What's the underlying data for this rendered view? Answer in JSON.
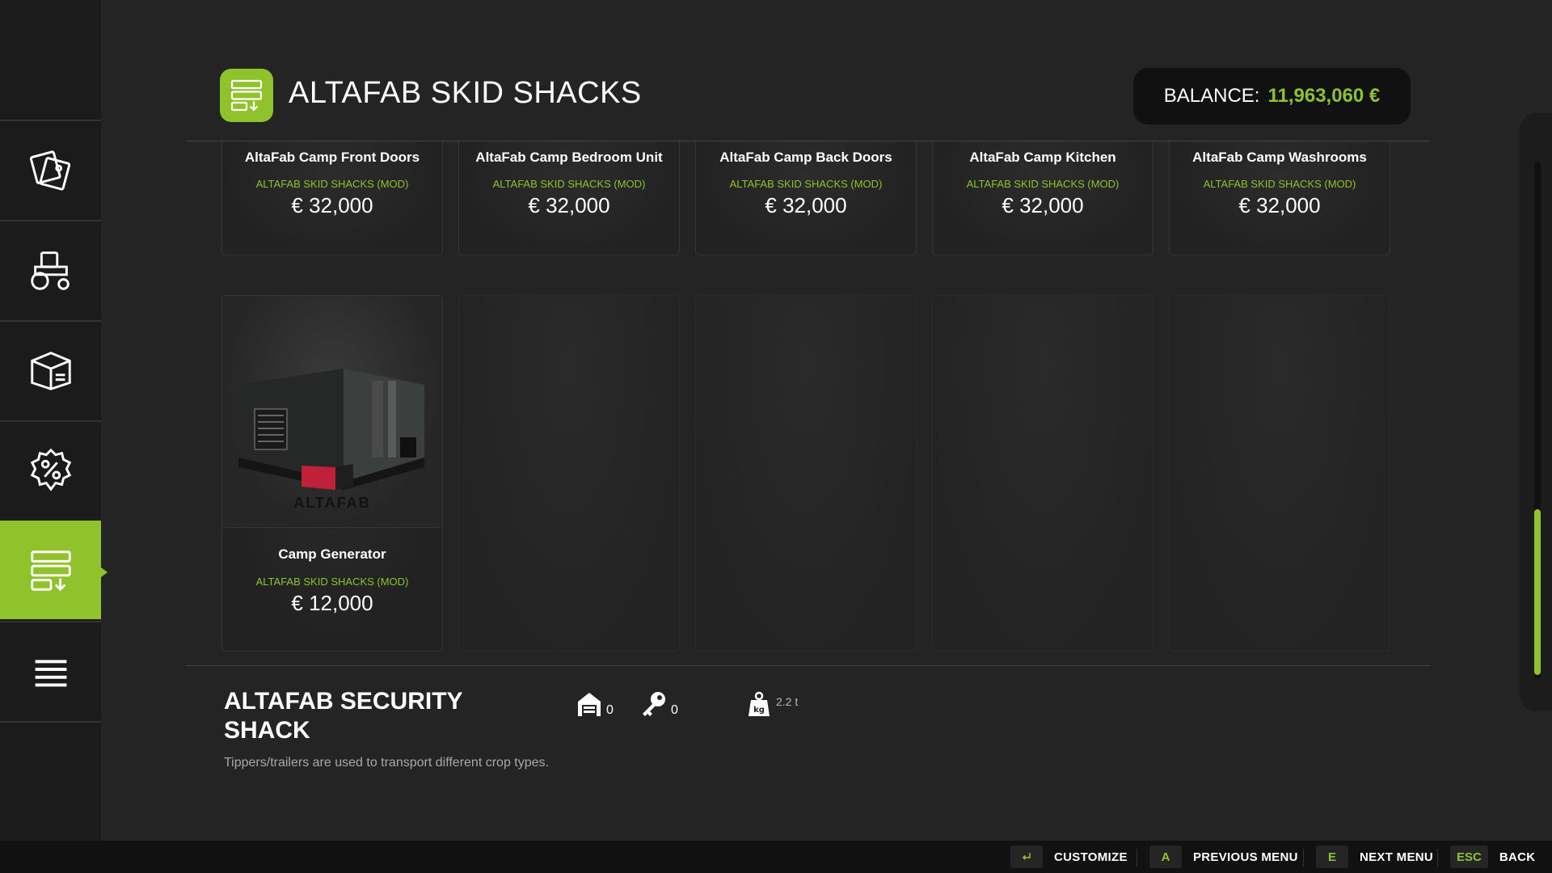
{
  "header": {
    "title": "ALTAFAB SKID SHACKS",
    "balance_label": "BALANCE:",
    "balance_value": "11,963,060 €",
    "icon": "skid-shack-icon"
  },
  "sidebar": {
    "items": [
      {
        "name": "tag-icon"
      },
      {
        "name": "tractor-icon"
      },
      {
        "name": "box-icon"
      },
      {
        "name": "percent-badge-icon"
      },
      {
        "name": "skid-shack-icon",
        "active": true
      },
      {
        "name": "list-icon"
      }
    ]
  },
  "items_row1": [
    {
      "name": "AltaFab Camp Front Doors",
      "category": "ALTAFAB SKID SHACKS (MOD)",
      "price": "€ 32,000"
    },
    {
      "name": "AltaFab Camp Bedroom Unit",
      "category": "ALTAFAB SKID SHACKS (MOD)",
      "price": "€ 32,000"
    },
    {
      "name": "AltaFab Camp Back Doors",
      "category": "ALTAFAB SKID SHACKS (MOD)",
      "price": "€ 32,000"
    },
    {
      "name": "AltaFab Camp Kitchen",
      "category": "ALTAFAB SKID SHACKS (MOD)",
      "price": "€ 32,000"
    },
    {
      "name": "AltaFab Camp Washrooms",
      "category": "ALTAFAB SKID SHACKS (MOD)",
      "price": "€ 32,000"
    }
  ],
  "items_row2": [
    {
      "name": "Camp Generator",
      "category": "ALTAFAB SKID SHACKS (MOD)",
      "price": "€ 12,000",
      "logo_text": "ALTAFAB"
    }
  ],
  "detail": {
    "title": "ALTAFAB SECURITY SHACK",
    "garage_count": "0",
    "key_count": "0",
    "weight": "2.2 t",
    "description": "Tippers/trailers are used to transport different crop types."
  },
  "footer": {
    "customize_label": "CUSTOMIZE",
    "prev_key": "A",
    "prev_label": "PREVIOUS MENU",
    "next_key": "E",
    "next_label": "NEXT MENU",
    "back_key": "ESC",
    "back_label": "BACK"
  },
  "scroll": {
    "position_fraction": 0.75
  },
  "colors": {
    "accent": "#8fc22b",
    "background": "#242424",
    "sidebar": "#1b1b1b"
  }
}
